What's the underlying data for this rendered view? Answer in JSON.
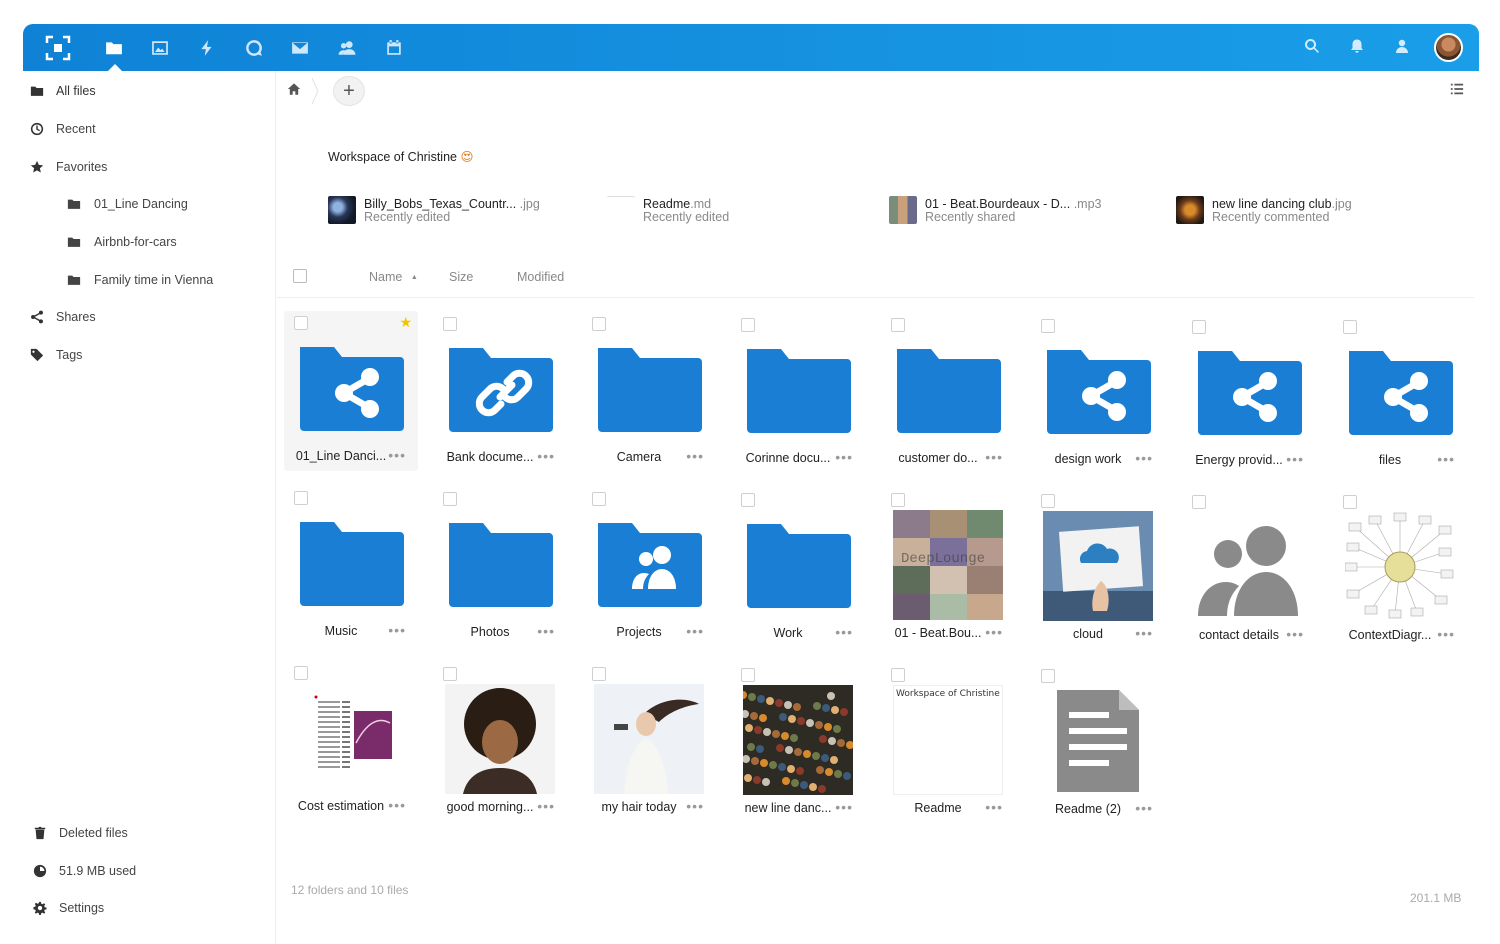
{
  "colors": {
    "accent": "#0f82d6",
    "folder": "#1a7fd4",
    "generic_file": "#888888",
    "star": "#f5c400"
  },
  "topbar": {
    "apps": [
      {
        "name": "files-icon",
        "active": true
      },
      {
        "name": "photos-icon"
      },
      {
        "name": "activity-icon"
      },
      {
        "name": "talk-icon"
      },
      {
        "name": "mail-icon"
      },
      {
        "name": "contacts-icon"
      },
      {
        "name": "calendar-icon"
      }
    ],
    "right": [
      "search-icon",
      "notifications-icon",
      "contacts-menu-icon",
      "user-avatar"
    ]
  },
  "sidebar": {
    "items": [
      {
        "label": "All files",
        "icon": "folder-icon"
      },
      {
        "label": "Recent",
        "icon": "clock-icon"
      },
      {
        "label": "Favorites",
        "icon": "star-icon"
      },
      {
        "label": "01_Line Dancing",
        "icon": "folder-icon"
      },
      {
        "label": "Airbnb-for-cars",
        "icon": "folder-icon"
      },
      {
        "label": "Family time in Vienna",
        "icon": "folder-icon"
      },
      {
        "label": "Shares",
        "icon": "share-icon"
      },
      {
        "label": "Tags",
        "icon": "tag-icon"
      }
    ],
    "bottom": [
      {
        "label": "Deleted files",
        "icon": "trash-icon"
      },
      {
        "label": "51.9 MB used",
        "icon": "quota-icon"
      },
      {
        "label": "Settings",
        "icon": "gear-icon"
      }
    ]
  },
  "main": {
    "workspace_title": "Workspace of Christine",
    "workspace_emoji": "😍",
    "recent": [
      {
        "name": "Billy_Bobs_Texas_Countr...",
        "ext": " .jpg",
        "sub": "Recently edited"
      },
      {
        "name": "Readme",
        "ext": ".md",
        "sub": "Recently edited"
      },
      {
        "name": "01 - Beat.Bourdeaux - D...",
        "ext": " .mp3",
        "sub": "Recently shared"
      },
      {
        "name": "new line dancing club",
        "ext": ".jpg",
        "sub": "Recently commented"
      }
    ],
    "columns": {
      "name": "Name",
      "sort_arrow": "▲",
      "size": "Size",
      "modified": "Modified"
    },
    "files": [
      {
        "name": "01_Line Danci...",
        "type": "shared-folder",
        "favorite": true
      },
      {
        "name": "Bank docume...",
        "type": "link-folder"
      },
      {
        "name": "Camera",
        "type": "folder"
      },
      {
        "name": "Corinne docu...",
        "type": "folder"
      },
      {
        "name": "customer do...",
        "type": "folder"
      },
      {
        "name": "design work",
        "type": "shared-folder"
      },
      {
        "name": "Energy provid...",
        "type": "shared-folder"
      },
      {
        "name": "files",
        "type": "shared-folder"
      },
      {
        "name": "Music",
        "type": "folder"
      },
      {
        "name": "Photos",
        "type": "folder"
      },
      {
        "name": "Projects",
        "type": "group-folder"
      },
      {
        "name": "Work",
        "type": "folder"
      },
      {
        "name": "01 - Beat.Bou...",
        "type": "image-mosaic",
        "overlay_text": "DeepLounge"
      },
      {
        "name": "cloud",
        "type": "image-cloud"
      },
      {
        "name": "contact details",
        "type": "contact"
      },
      {
        "name": "ContextDiagr...",
        "type": "image-diagram"
      },
      {
        "name": "Cost estimation",
        "type": "image-spreadsheet"
      },
      {
        "name": "good morning...",
        "type": "image-portrait"
      },
      {
        "name": "my hair today",
        "type": "image-hair"
      },
      {
        "name": "new line danc...",
        "type": "image-crowd"
      },
      {
        "name": "Readme",
        "type": "text-preview",
        "preview_text": "Workspace of Christine ð("
      },
      {
        "name": "Readme (2)",
        "type": "document"
      }
    ],
    "more_label": "•••",
    "summary": "12 folders and 10 files",
    "total_size": "201.1 MB"
  },
  "breadcrumb": {
    "add_label": "+"
  }
}
